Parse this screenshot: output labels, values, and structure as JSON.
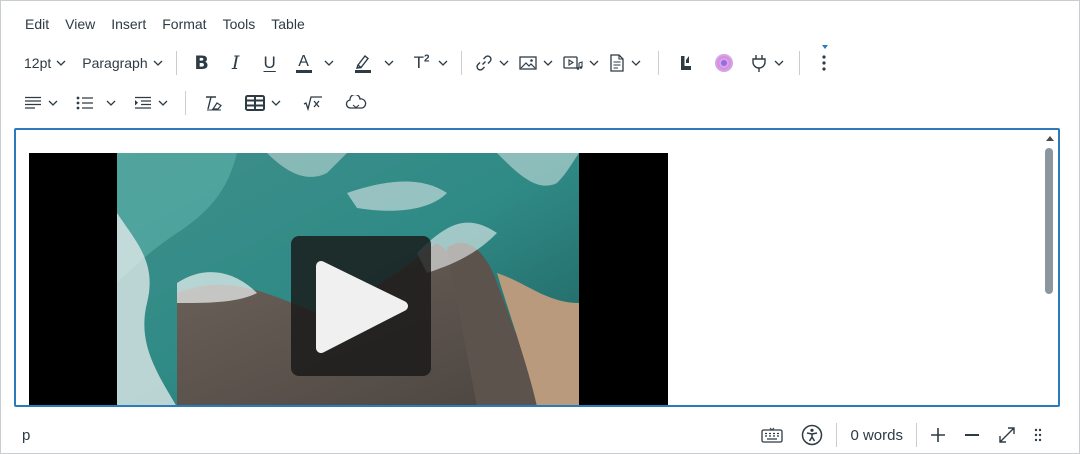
{
  "menubar": {
    "items": [
      "Edit",
      "View",
      "Insert",
      "Format",
      "Tools",
      "Table"
    ]
  },
  "toolbar": {
    "font_size": "12pt",
    "block_format": "Paragraph",
    "bold_glyph": "B",
    "italic_glyph": "I",
    "underline_glyph": "U",
    "text_color_glyph": "A",
    "superscript_glyph": "T",
    "superscript_mark": "2",
    "text_color": "#2d3b45",
    "highlight_color": "#2d3b45"
  },
  "editor": {
    "border_color": "#2b7abc",
    "video": {
      "icon": "play-icon"
    }
  },
  "statusbar": {
    "path": "p",
    "word_count": "0 words"
  },
  "colors": {
    "text": "#2d3b45",
    "border": "#c7cdd1",
    "focus": "#2b7abc"
  }
}
